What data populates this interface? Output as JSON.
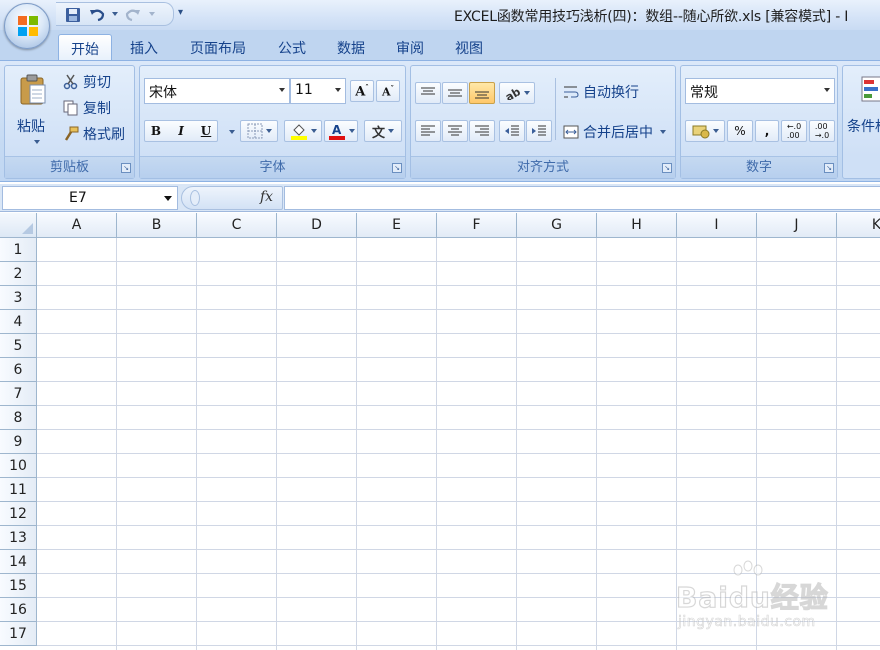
{
  "window": {
    "title": "EXCEL函数常用技巧浅析(四)：数组--随心所欲.xls  [兼容模式] - I"
  },
  "tabs": [
    {
      "label": "开始",
      "active": true
    },
    {
      "label": "插入"
    },
    {
      "label": "页面布局"
    },
    {
      "label": "公式"
    },
    {
      "label": "数据"
    },
    {
      "label": "审阅"
    },
    {
      "label": "视图"
    }
  ],
  "clipboard": {
    "paste_label": "粘贴",
    "cut_label": "剪切",
    "copy_label": "复制",
    "format_painter_label": "格式刷",
    "group_label": "剪贴板"
  },
  "font": {
    "font_name": "宋体",
    "font_size": "11",
    "bold": "B",
    "italic": "I",
    "underline": "U",
    "group_label": "字体",
    "font_color": "#e01010",
    "fill_color": "#ffff00"
  },
  "alignment": {
    "wrap_text_label": "自动换行",
    "merge_center_label": "合并后居中",
    "group_label": "对齐方式"
  },
  "number": {
    "format": "常规",
    "percent": "%",
    "comma": ",",
    "group_label": "数字"
  },
  "styles": {
    "conditional_label": "条件格"
  },
  "formula_bar": {
    "name_box": "E7",
    "fx": "fx",
    "formula": ""
  },
  "grid": {
    "columns": [
      "A",
      "B",
      "C",
      "D",
      "E",
      "F",
      "G",
      "H",
      "I",
      "J",
      "K"
    ],
    "rows": [
      "1",
      "2",
      "3",
      "4",
      "5",
      "6",
      "7",
      "8",
      "9",
      "10",
      "11",
      "12",
      "13",
      "14",
      "15",
      "16",
      "17"
    ]
  },
  "watermark": {
    "brand": "Baidu经验",
    "url": "jingyan.baidu.com"
  }
}
